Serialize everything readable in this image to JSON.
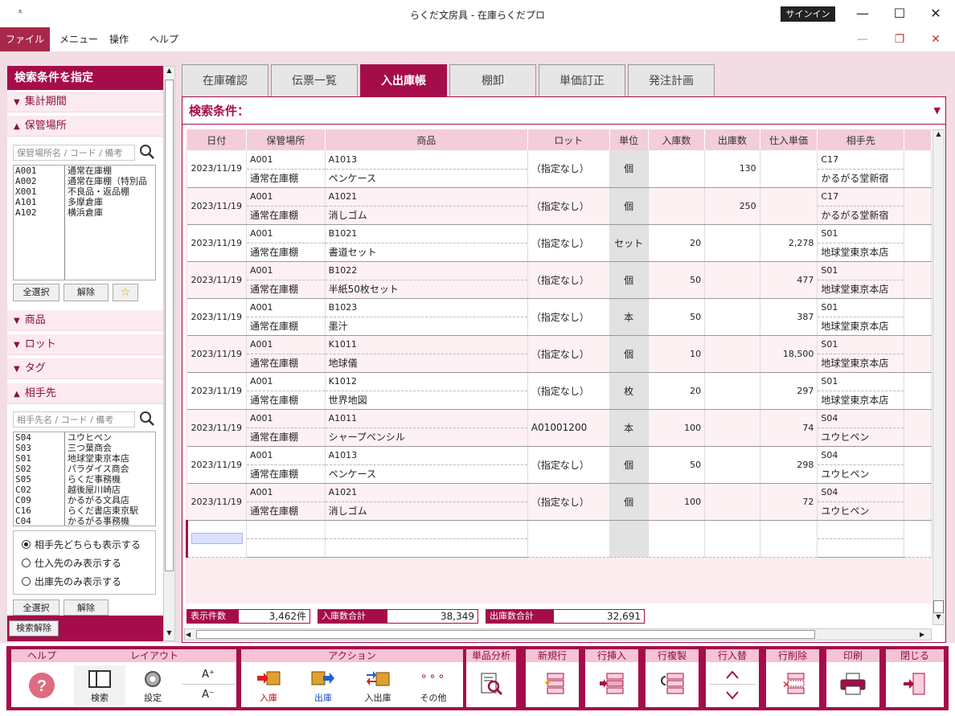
{
  "window": {
    "title": "らくだ文房具 - 在庫らくだプロ",
    "signin": "サインイン",
    "quick_access": "⩡",
    "minimize": "—",
    "maximize": "☐",
    "close": "✕"
  },
  "menubar": {
    "items": [
      "ファイル",
      "メニュー",
      "操作",
      "ヘルプ"
    ],
    "min": "—",
    "restore": "❐",
    "close": "✕"
  },
  "left": {
    "header": "検索条件を指定",
    "sections": {
      "period": "集計期間",
      "storage": "保管場所",
      "product": "商品",
      "lot": "ロット",
      "tag": "タグ",
      "partner": "相手先"
    },
    "storage_search_placeholder": "保管場所名 / コード / 備考",
    "storage_list": [
      {
        "code": "A001",
        "name": "通常在庫棚"
      },
      {
        "code": "A002",
        "name": "通常在庫棚（特別品"
      },
      {
        "code": "X001",
        "name": "不良品・返品棚"
      },
      {
        "code": "A101",
        "name": "多摩倉庫"
      },
      {
        "code": "A102",
        "name": "横浜倉庫"
      }
    ],
    "select_all": "全選択",
    "clear": "解除",
    "star": "☆",
    "partner_search_placeholder": "相手先名 / コード / 備考",
    "partner_list": [
      {
        "code": "S04",
        "name": "ユウヒペン"
      },
      {
        "code": "S03",
        "name": "三つ葉商会"
      },
      {
        "code": "S01",
        "name": "地球堂東京本店"
      },
      {
        "code": "S02",
        "name": "パラダイス商会"
      },
      {
        "code": "S05",
        "name": "らくだ事務機"
      },
      {
        "code": "C02",
        "name": "越後屋川崎店"
      },
      {
        "code": "C09",
        "name": "かるがる文具店"
      },
      {
        "code": "C16",
        "name": "らくだ書店東京駅"
      },
      {
        "code": "C04",
        "name": "かるがる事務機"
      }
    ],
    "radio": [
      "相手先どちらも表示する",
      "仕入先のみ表示する",
      "出庫先のみ表示する"
    ],
    "radio_selected": 0,
    "reset": "検索解除"
  },
  "tabs": [
    "在庫確認",
    "伝票一覧",
    "入出庫帳",
    "棚卸",
    "単価訂正",
    "発注計画"
  ],
  "active_tab": 2,
  "search_condition": "検索条件：",
  "grid": {
    "headers": [
      "日付",
      "保管場所",
      "商品",
      "ロット",
      "単位",
      "入庫数",
      "出庫数",
      "仕入単価",
      "相手先"
    ],
    "rows": [
      {
        "date": "2023/11/19",
        "loc_code": "A001",
        "loc_name": "通常在庫棚",
        "prod_code": "A1013",
        "prod_name": "ペンケース",
        "lot": "（指定なし）",
        "unit": "個",
        "in": "",
        "out": "130",
        "price": "",
        "partner_code": "C17",
        "partner_name": "かるがる堂新宿"
      },
      {
        "date": "2023/11/19",
        "loc_code": "A001",
        "loc_name": "通常在庫棚",
        "prod_code": "A1021",
        "prod_name": "消しゴム",
        "lot": "（指定なし）",
        "unit": "個",
        "in": "",
        "out": "250",
        "price": "",
        "partner_code": "C17",
        "partner_name": "かるがる堂新宿"
      },
      {
        "date": "2023/11/19",
        "loc_code": "A001",
        "loc_name": "通常在庫棚",
        "prod_code": "B1021",
        "prod_name": "書道セット",
        "lot": "（指定なし）",
        "unit": "セット",
        "in": "20",
        "out": "",
        "price": "2,278",
        "partner_code": "S01",
        "partner_name": "地球堂東京本店"
      },
      {
        "date": "2023/11/19",
        "loc_code": "A001",
        "loc_name": "通常在庫棚",
        "prod_code": "B1022",
        "prod_name": "半紙50枚セット",
        "lot": "（指定なし）",
        "unit": "個",
        "in": "50",
        "out": "",
        "price": "477",
        "partner_code": "S01",
        "partner_name": "地球堂東京本店"
      },
      {
        "date": "2023/11/19",
        "loc_code": "A001",
        "loc_name": "通常在庫棚",
        "prod_code": "B1023",
        "prod_name": "墨汁",
        "lot": "（指定なし）",
        "unit": "本",
        "in": "50",
        "out": "",
        "price": "387",
        "partner_code": "S01",
        "partner_name": "地球堂東京本店"
      },
      {
        "date": "2023/11/19",
        "loc_code": "A001",
        "loc_name": "通常在庫棚",
        "prod_code": "K1011",
        "prod_name": "地球儀",
        "lot": "（指定なし）",
        "unit": "個",
        "in": "10",
        "out": "",
        "price": "18,500",
        "partner_code": "S01",
        "partner_name": "地球堂東京本店"
      },
      {
        "date": "2023/11/19",
        "loc_code": "A001",
        "loc_name": "通常在庫棚",
        "prod_code": "K1012",
        "prod_name": "世界地図",
        "lot": "（指定なし）",
        "unit": "枚",
        "in": "20",
        "out": "",
        "price": "297",
        "partner_code": "S01",
        "partner_name": "地球堂東京本店"
      },
      {
        "date": "2023/11/19",
        "loc_code": "A001",
        "loc_name": "通常在庫棚",
        "prod_code": "A1011",
        "prod_name": "シャープペンシル",
        "lot": "A01001200",
        "unit": "本",
        "in": "100",
        "out": "",
        "price": "74",
        "partner_code": "S04",
        "partner_name": "ユウヒペン"
      },
      {
        "date": "2023/11/19",
        "loc_code": "A001",
        "loc_name": "通常在庫棚",
        "prod_code": "A1013",
        "prod_name": "ペンケース",
        "lot": "（指定なし）",
        "unit": "個",
        "in": "50",
        "out": "",
        "price": "298",
        "partner_code": "S04",
        "partner_name": "ユウヒペン"
      },
      {
        "date": "2023/11/19",
        "loc_code": "A001",
        "loc_name": "通常在庫棚",
        "prod_code": "A1021",
        "prod_name": "消しゴム",
        "lot": "（指定なし）",
        "unit": "個",
        "in": "100",
        "out": "",
        "price": "72",
        "partner_code": "S04",
        "partner_name": "ユウヒペン"
      }
    ]
  },
  "summary": {
    "count_label": "表示件数",
    "count_value": "3,462件",
    "in_label": "入庫数合計",
    "in_value": "38,349",
    "out_label": "出庫数合計",
    "out_value": "32,691"
  },
  "toolbar": {
    "help_group": "ヘルプ",
    "layout_group": "レイアウト",
    "search": "検索",
    "settings": "設定",
    "font_up": "A⁺",
    "font_down": "A⁻",
    "action_group": "アクション",
    "in": "入庫",
    "out": "出庫",
    "inout": "入出庫",
    "other": "その他",
    "other_icon": "∘∘∘",
    "analysis_group": "単品分析",
    "new_group": "新規行",
    "insert_group": "行挿入",
    "copy_group": "行複製",
    "swap_group": "行入替",
    "delete_group": "行削除",
    "print_group": "印刷",
    "close_group": "閉じる"
  },
  "colors": {
    "accent": "#a50d4a",
    "pink_bg": "#f1dde3"
  }
}
